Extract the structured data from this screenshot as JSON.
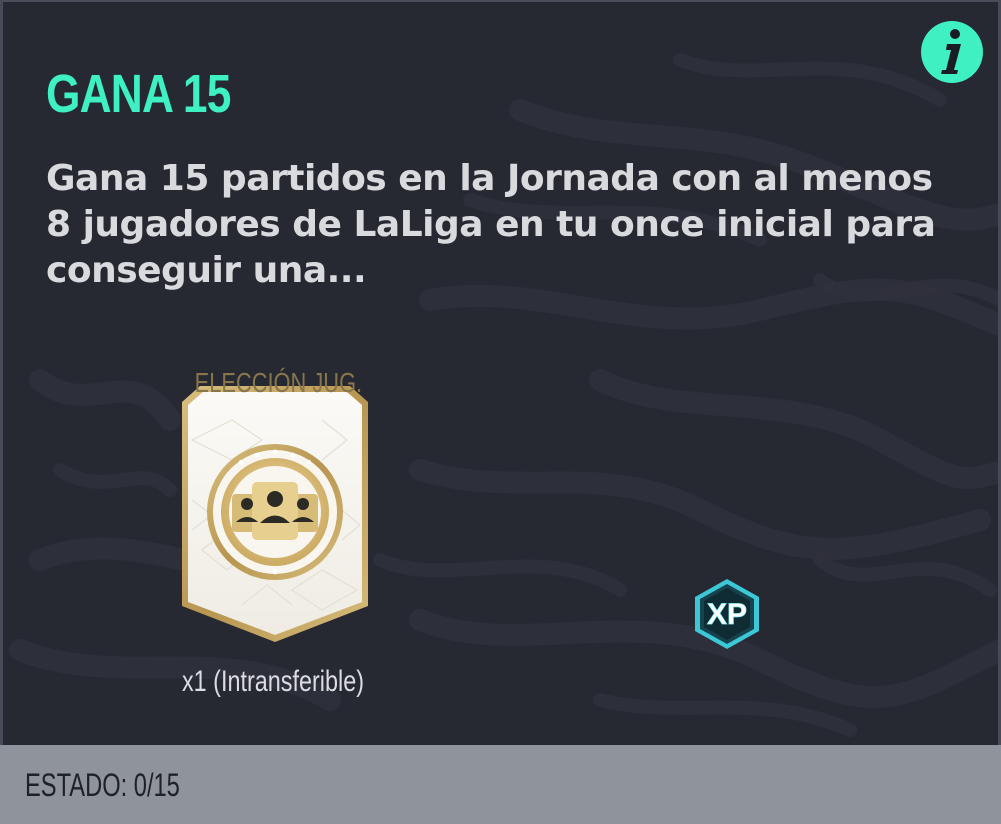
{
  "objective": {
    "title": "GANA 15",
    "description": "Gana 15 partidos en la Jornada con al menos 8 jugadores de LaLiga en tu once inicial para conseguir una..."
  },
  "icons": {
    "info": "info-icon",
    "xp": "xp-badge-icon",
    "pack": "player-pick-pack-icon"
  },
  "rewards": {
    "pack_label": "ELECCIÓN JUG.",
    "pack_quantity": "x1 (Intransferible)",
    "xp_label": "XP"
  },
  "status": {
    "text": "ESTADO: 0/15"
  },
  "colors": {
    "accent": "#3ef0c2",
    "background": "#262832",
    "status_bar": "#8e939c",
    "gold": "#c9aa63"
  }
}
